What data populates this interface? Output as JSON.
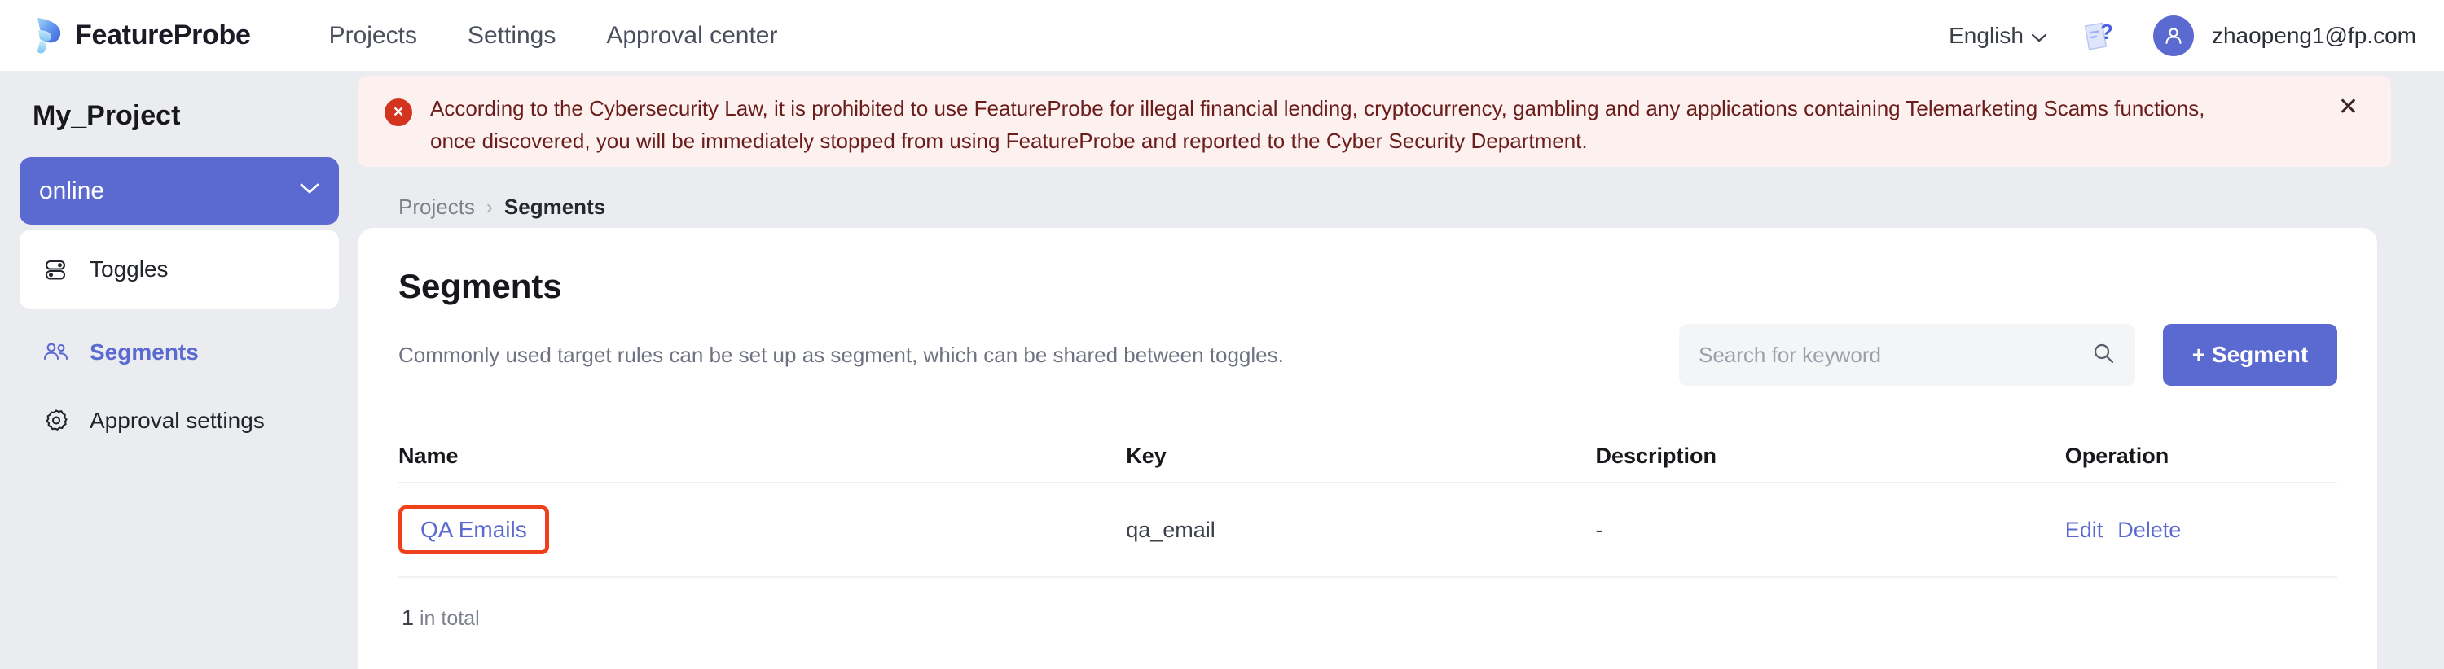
{
  "header": {
    "brand": "FeatureProbe",
    "brand_logo_icon": "feather-logo-icon",
    "nav": [
      {
        "label": "Projects"
      },
      {
        "label": "Settings"
      },
      {
        "label": "Approval center"
      }
    ],
    "language": {
      "label": "English",
      "chevron": "⌄"
    },
    "help_icon": "help-document-icon",
    "avatar_icon": "user-avatar-icon",
    "user_email": "zhaopeng1@fp.com"
  },
  "banner": {
    "severity_icon": "error-circle-x-icon",
    "icon_glyph": "×",
    "text": "According to the Cybersecurity Law, it is prohibited to use FeatureProbe for illegal financial lending, cryptocurrency, gambling and any applications containing Telemarketing Scams functions, once discovered, you will be immediately stopped from using FeatureProbe and reported to the Cyber Security Department.",
    "close_glyph": "✕",
    "bg_color": "#fdf1ef",
    "text_color": "#6b1d1c",
    "icon_color": "#d4341f"
  },
  "sidebar": {
    "project_title": "My_Project",
    "environment": {
      "label": "online",
      "chevron": "⌄",
      "color": "#5b6ad0"
    },
    "card_items": [
      {
        "label": "Toggles",
        "icon": "toggles-icon",
        "active": false
      }
    ],
    "items": [
      {
        "label": "Segments",
        "icon": "segments-people-icon",
        "active": true
      },
      {
        "label": "Approval settings",
        "icon": "gear-icon",
        "active": false
      }
    ]
  },
  "breadcrumb": {
    "parent": "Projects",
    "separator": "›",
    "current": "Segments"
  },
  "main": {
    "title": "Segments",
    "subtitle": "Commonly used target rules can be set up as segment, which can be shared between toggles.",
    "search": {
      "placeholder": "Search for keyword",
      "value": "",
      "icon": "search-icon"
    },
    "add_button": {
      "label": "+ Segment",
      "color": "#5b6ad0"
    },
    "table": {
      "columns": [
        "Name",
        "Key",
        "Description",
        "Operation"
      ],
      "rows": [
        {
          "name": "QA Emails",
          "key": "qa_email",
          "description": "-",
          "operations": [
            "Edit",
            "Delete"
          ],
          "highlighted": true,
          "highlight_color": "#f0401b"
        }
      ]
    },
    "total": {
      "count": "1",
      "suffix": "in total"
    }
  }
}
